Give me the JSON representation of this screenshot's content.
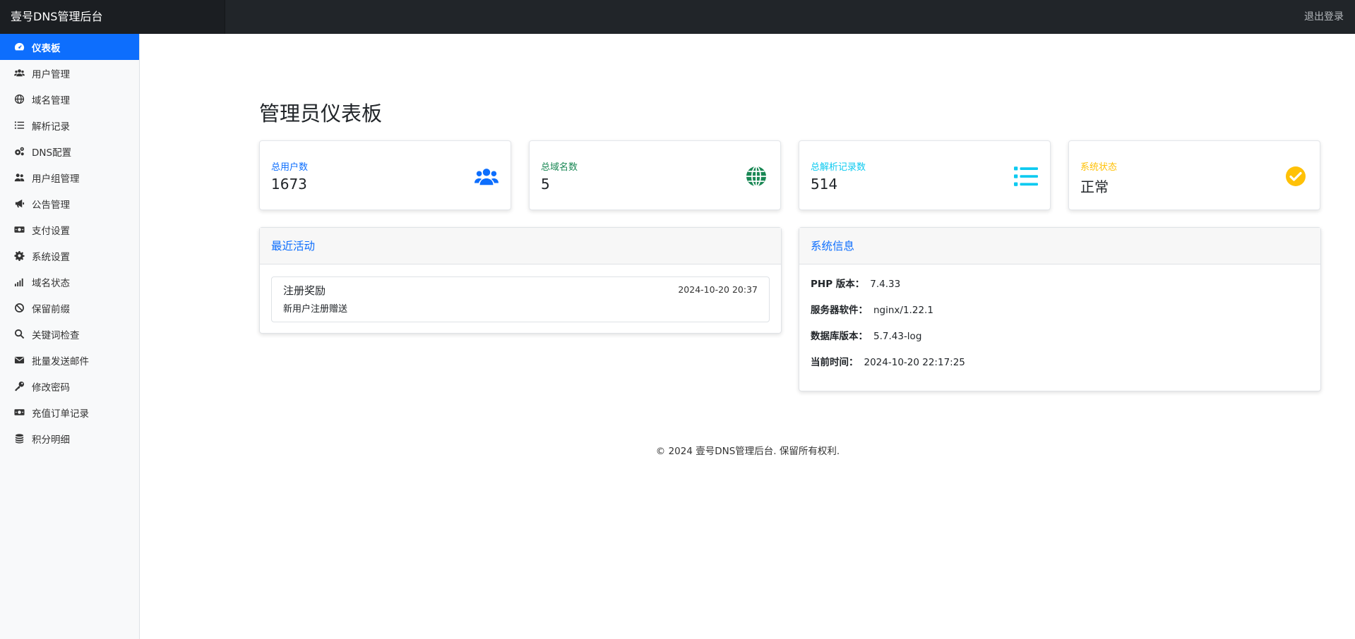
{
  "app": {
    "brand": "壹号DNS管理后台",
    "logout_label": "退出登录"
  },
  "sidebar": {
    "items": [
      {
        "label": "仪表板",
        "icon": "dashboard-icon",
        "active": true
      },
      {
        "label": "用户管理",
        "icon": "users-icon"
      },
      {
        "label": "域名管理",
        "icon": "globe-icon"
      },
      {
        "label": "解析记录",
        "icon": "list-icon"
      },
      {
        "label": "DNS配置",
        "icon": "gears-icon"
      },
      {
        "label": "用户组管理",
        "icon": "user-group-icon"
      },
      {
        "label": "公告管理",
        "icon": "megaphone-icon"
      },
      {
        "label": "支付设置",
        "icon": "money-icon"
      },
      {
        "label": "系统设置",
        "icon": "gear-icon"
      },
      {
        "label": "域名状态",
        "icon": "signal-icon"
      },
      {
        "label": "保留前缀",
        "icon": "ban-icon"
      },
      {
        "label": "关键词检查",
        "icon": "search-icon"
      },
      {
        "label": "批量发送邮件",
        "icon": "envelope-icon"
      },
      {
        "label": "修改密码",
        "icon": "key-icon"
      },
      {
        "label": "充值订单记录",
        "icon": "money-icon"
      },
      {
        "label": "积分明细",
        "icon": "coins-icon"
      }
    ]
  },
  "page": {
    "title": "管理员仪表板"
  },
  "stats": [
    {
      "label": "总用户数",
      "value": "1673",
      "color": "#0d6efd",
      "icon": "users-icon"
    },
    {
      "label": "总域名数",
      "value": "5",
      "color": "#198754",
      "icon": "globe-icon"
    },
    {
      "label": "总解析记录数",
      "value": "514",
      "color": "#0dcaf0",
      "icon": "list-icon"
    },
    {
      "label": "系统状态",
      "value": "正常",
      "color": "#ffc107",
      "icon": "check-circle-icon"
    }
  ],
  "recent": {
    "title": "最近活动",
    "items": [
      {
        "title": "注册奖励",
        "time": "2024-10-20 20:37",
        "desc": "新用户注册赠送"
      }
    ]
  },
  "sysinfo": {
    "title": "系统信息",
    "rows": [
      {
        "key": "PHP 版本：",
        "value": "7.4.33"
      },
      {
        "key": "服务器软件：",
        "value": "nginx/1.22.1"
      },
      {
        "key": "数据库版本：",
        "value": "5.7.43-log"
      },
      {
        "key": "当前时间：",
        "value": "2024-10-20 22:17:25"
      }
    ]
  },
  "footer": {
    "text": "© 2024 壹号DNS管理后台. 保留所有权利."
  }
}
